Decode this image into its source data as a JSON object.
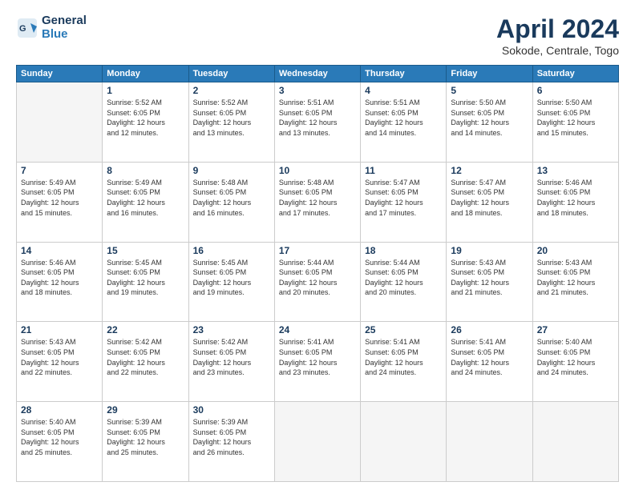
{
  "header": {
    "logo_line1": "General",
    "logo_line2": "Blue",
    "month_year": "April 2024",
    "location": "Sokode, Centrale, Togo"
  },
  "weekdays": [
    "Sunday",
    "Monday",
    "Tuesday",
    "Wednesday",
    "Thursday",
    "Friday",
    "Saturday"
  ],
  "days": [
    {
      "num": "",
      "info": ""
    },
    {
      "num": "1",
      "info": "Sunrise: 5:52 AM\nSunset: 6:05 PM\nDaylight: 12 hours\nand 12 minutes."
    },
    {
      "num": "2",
      "info": "Sunrise: 5:52 AM\nSunset: 6:05 PM\nDaylight: 12 hours\nand 13 minutes."
    },
    {
      "num": "3",
      "info": "Sunrise: 5:51 AM\nSunset: 6:05 PM\nDaylight: 12 hours\nand 13 minutes."
    },
    {
      "num": "4",
      "info": "Sunrise: 5:51 AM\nSunset: 6:05 PM\nDaylight: 12 hours\nand 14 minutes."
    },
    {
      "num": "5",
      "info": "Sunrise: 5:50 AM\nSunset: 6:05 PM\nDaylight: 12 hours\nand 14 minutes."
    },
    {
      "num": "6",
      "info": "Sunrise: 5:50 AM\nSunset: 6:05 PM\nDaylight: 12 hours\nand 15 minutes."
    },
    {
      "num": "7",
      "info": "Sunrise: 5:49 AM\nSunset: 6:05 PM\nDaylight: 12 hours\nand 15 minutes."
    },
    {
      "num": "8",
      "info": "Sunrise: 5:49 AM\nSunset: 6:05 PM\nDaylight: 12 hours\nand 16 minutes."
    },
    {
      "num": "9",
      "info": "Sunrise: 5:48 AM\nSunset: 6:05 PM\nDaylight: 12 hours\nand 16 minutes."
    },
    {
      "num": "10",
      "info": "Sunrise: 5:48 AM\nSunset: 6:05 PM\nDaylight: 12 hours\nand 17 minutes."
    },
    {
      "num": "11",
      "info": "Sunrise: 5:47 AM\nSunset: 6:05 PM\nDaylight: 12 hours\nand 17 minutes."
    },
    {
      "num": "12",
      "info": "Sunrise: 5:47 AM\nSunset: 6:05 PM\nDaylight: 12 hours\nand 18 minutes."
    },
    {
      "num": "13",
      "info": "Sunrise: 5:46 AM\nSunset: 6:05 PM\nDaylight: 12 hours\nand 18 minutes."
    },
    {
      "num": "14",
      "info": "Sunrise: 5:46 AM\nSunset: 6:05 PM\nDaylight: 12 hours\nand 18 minutes."
    },
    {
      "num": "15",
      "info": "Sunrise: 5:45 AM\nSunset: 6:05 PM\nDaylight: 12 hours\nand 19 minutes."
    },
    {
      "num": "16",
      "info": "Sunrise: 5:45 AM\nSunset: 6:05 PM\nDaylight: 12 hours\nand 19 minutes."
    },
    {
      "num": "17",
      "info": "Sunrise: 5:44 AM\nSunset: 6:05 PM\nDaylight: 12 hours\nand 20 minutes."
    },
    {
      "num": "18",
      "info": "Sunrise: 5:44 AM\nSunset: 6:05 PM\nDaylight: 12 hours\nand 20 minutes."
    },
    {
      "num": "19",
      "info": "Sunrise: 5:43 AM\nSunset: 6:05 PM\nDaylight: 12 hours\nand 21 minutes."
    },
    {
      "num": "20",
      "info": "Sunrise: 5:43 AM\nSunset: 6:05 PM\nDaylight: 12 hours\nand 21 minutes."
    },
    {
      "num": "21",
      "info": "Sunrise: 5:43 AM\nSunset: 6:05 PM\nDaylight: 12 hours\nand 22 minutes."
    },
    {
      "num": "22",
      "info": "Sunrise: 5:42 AM\nSunset: 6:05 PM\nDaylight: 12 hours\nand 22 minutes."
    },
    {
      "num": "23",
      "info": "Sunrise: 5:42 AM\nSunset: 6:05 PM\nDaylight: 12 hours\nand 23 minutes."
    },
    {
      "num": "24",
      "info": "Sunrise: 5:41 AM\nSunset: 6:05 PM\nDaylight: 12 hours\nand 23 minutes."
    },
    {
      "num": "25",
      "info": "Sunrise: 5:41 AM\nSunset: 6:05 PM\nDaylight: 12 hours\nand 24 minutes."
    },
    {
      "num": "26",
      "info": "Sunrise: 5:41 AM\nSunset: 6:05 PM\nDaylight: 12 hours\nand 24 minutes."
    },
    {
      "num": "27",
      "info": "Sunrise: 5:40 AM\nSunset: 6:05 PM\nDaylight: 12 hours\nand 24 minutes."
    },
    {
      "num": "28",
      "info": "Sunrise: 5:40 AM\nSunset: 6:05 PM\nDaylight: 12 hours\nand 25 minutes."
    },
    {
      "num": "29",
      "info": "Sunrise: 5:39 AM\nSunset: 6:05 PM\nDaylight: 12 hours\nand 25 minutes."
    },
    {
      "num": "30",
      "info": "Sunrise: 5:39 AM\nSunset: 6:05 PM\nDaylight: 12 hours\nand 26 minutes."
    },
    {
      "num": "",
      "info": ""
    },
    {
      "num": "",
      "info": ""
    },
    {
      "num": "",
      "info": ""
    },
    {
      "num": "",
      "info": ""
    }
  ]
}
